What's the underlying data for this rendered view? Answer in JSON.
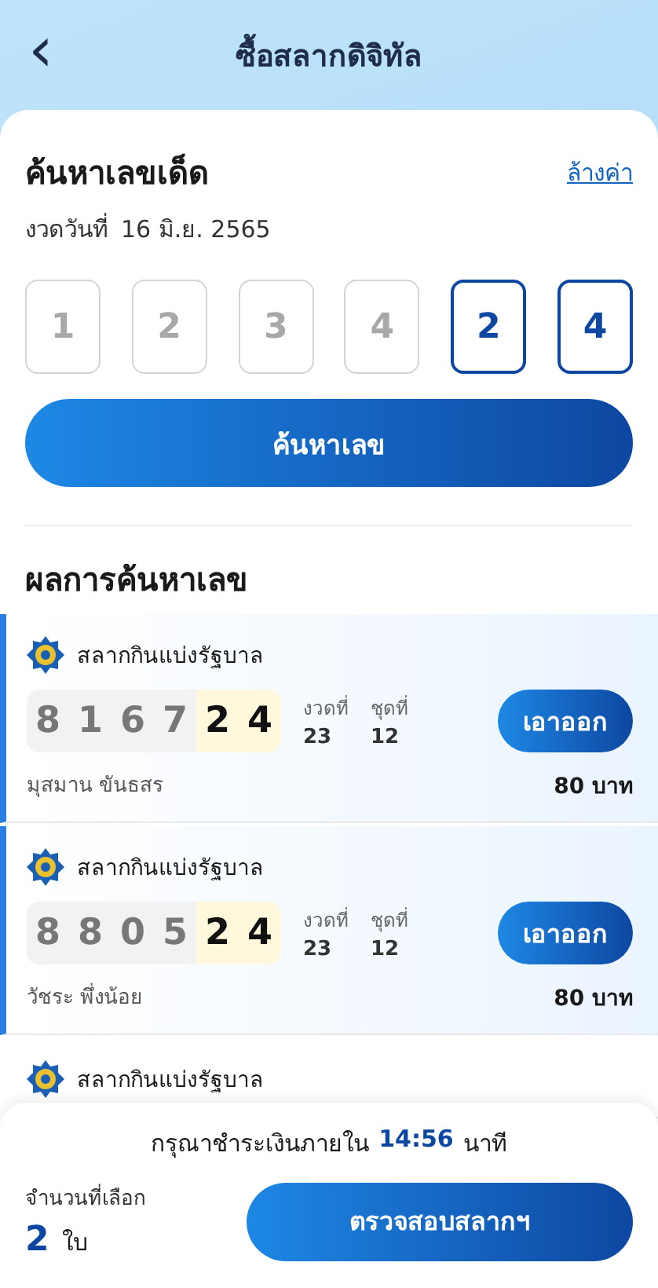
{
  "header": {
    "back_icon": "‹",
    "title": "ซื้อสลากดิจิทัล"
  },
  "search": {
    "title": "ค้นหาเลขเด็ด",
    "clear_link": "ล้างค่า",
    "draw_label": "งวดวันที่",
    "draw_date": "16 มิ.ย. 2565",
    "digits": [
      {
        "placeholder": "1"
      },
      {
        "placeholder": "2"
      },
      {
        "placeholder": "3"
      },
      {
        "placeholder": "4"
      },
      {
        "value": "2"
      },
      {
        "value": "4"
      }
    ],
    "button": "ค้นหาเลข"
  },
  "results": {
    "title": "ผลการค้นหาเลข",
    "items": [
      {
        "issuer": "สลากกินแบ่งรัฐบาล",
        "digits": [
          {
            "digit": "8",
            "matched": false
          },
          {
            "digit": "1",
            "matched": false
          },
          {
            "digit": "6",
            "matched": false
          },
          {
            "digit": "7",
            "matched": false
          },
          {
            "digit": "2",
            "matched": true
          },
          {
            "digit": "4",
            "matched": true
          }
        ],
        "draw_label": "งวดที่",
        "draw_no": "23",
        "set_label": "ชุดที่",
        "set_no": "12",
        "button": "เอาออก",
        "seller": "มุสมาน ขันธสร",
        "price": "80 บาท",
        "selected": true
      },
      {
        "issuer": "สลากกินแบ่งรัฐบาล",
        "digits": [
          {
            "digit": "8",
            "matched": false
          },
          {
            "digit": "8",
            "matched": false
          },
          {
            "digit": "0",
            "matched": false
          },
          {
            "digit": "5",
            "matched": false
          },
          {
            "digit": "2",
            "matched": true
          },
          {
            "digit": "4",
            "matched": true
          }
        ],
        "draw_label": "งวดที่",
        "draw_no": "23",
        "set_label": "ชุดที่",
        "set_no": "12",
        "button": "เอาออก",
        "seller": "วัชระ พึ่งน้อย",
        "price": "80 บาท",
        "selected": true
      },
      {
        "issuer": "สลากกินแบ่งรัฐบาล",
        "selected": false
      }
    ]
  },
  "footer": {
    "notice_before": "กรุณาชำระเงินภายใน",
    "timer": "14:56",
    "notice_after": "นาที",
    "count_label": "จำนวนที่เลือก",
    "count": "2",
    "count_unit": "ใบ",
    "button": "ตรวจสอบสลากฯ"
  }
}
